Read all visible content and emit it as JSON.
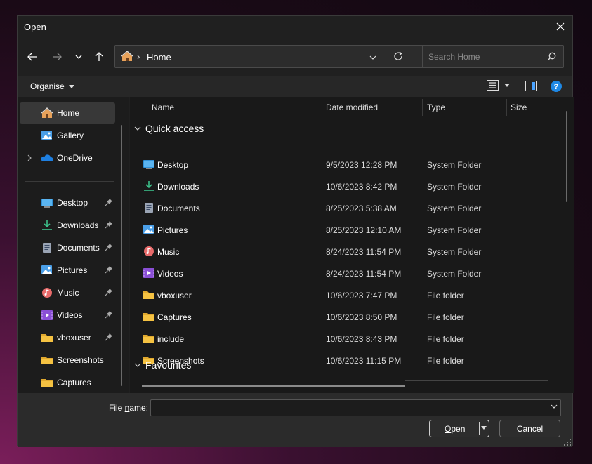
{
  "window": {
    "title": "Open"
  },
  "navigation": {
    "breadcrumb": "Home",
    "search_placeholder": "Search Home"
  },
  "toolbar": {
    "organise_label": "Organise"
  },
  "sidebar": {
    "top_items": [
      {
        "label": "Home",
        "icon": "home-icon",
        "selected": true
      },
      {
        "label": "Gallery",
        "icon": "gallery-icon"
      },
      {
        "label": "OneDrive",
        "icon": "onedrive-icon",
        "expandable": true
      }
    ],
    "pinned_items": [
      {
        "label": "Desktop",
        "icon": "desktop-icon",
        "pinned": true
      },
      {
        "label": "Downloads",
        "icon": "downloads-icon",
        "pinned": true
      },
      {
        "label": "Documents",
        "icon": "documents-icon",
        "pinned": true
      },
      {
        "label": "Pictures",
        "icon": "pictures-icon",
        "pinned": true
      },
      {
        "label": "Music",
        "icon": "music-icon",
        "pinned": true
      },
      {
        "label": "Videos",
        "icon": "videos-icon",
        "pinned": true
      },
      {
        "label": "vboxuser",
        "icon": "folder-icon",
        "pinned": true
      },
      {
        "label": "Screenshots",
        "icon": "folder-icon",
        "pinned": false
      },
      {
        "label": "Captures",
        "icon": "folder-icon",
        "pinned": false
      }
    ]
  },
  "file_list": {
    "columns": {
      "name": "Name",
      "date": "Date modified",
      "type": "Type",
      "size": "Size"
    },
    "groups": {
      "quick_access": "Quick access",
      "favourites": "Favourites"
    },
    "rows": [
      {
        "name": "Desktop",
        "date": "9/5/2023 12:28 PM",
        "type": "System Folder",
        "icon": "desktop-icon"
      },
      {
        "name": "Downloads",
        "date": "10/6/2023 8:42 PM",
        "type": "System Folder",
        "icon": "downloads-icon"
      },
      {
        "name": "Documents",
        "date": "8/25/2023 5:38 AM",
        "type": "System Folder",
        "icon": "documents-icon"
      },
      {
        "name": "Pictures",
        "date": "8/25/2023 12:10 AM",
        "type": "System Folder",
        "icon": "pictures-icon"
      },
      {
        "name": "Music",
        "date": "8/24/2023 11:54 PM",
        "type": "System Folder",
        "icon": "music-icon"
      },
      {
        "name": "Videos",
        "date": "8/24/2023 11:54 PM",
        "type": "System Folder",
        "icon": "videos-icon"
      },
      {
        "name": "vboxuser",
        "date": "10/6/2023 7:47 PM",
        "type": "File folder",
        "icon": "folder-icon"
      },
      {
        "name": "Captures",
        "date": "10/6/2023 8:50 PM",
        "type": "File folder",
        "icon": "folder-icon"
      },
      {
        "name": "include",
        "date": "10/6/2023 8:43 PM",
        "type": "File folder",
        "icon": "folder-icon"
      },
      {
        "name": "Screenshots",
        "date": "10/6/2023 11:15 PM",
        "type": "File folder",
        "icon": "folder-icon"
      }
    ]
  },
  "footer": {
    "file_name_label_pre": "File ",
    "file_name_label_u": "n",
    "file_name_label_post": "ame:",
    "file_name_value": "",
    "open_label_u": "O",
    "open_label_post": "pen",
    "cancel_label": "Cancel"
  },
  "colors": {
    "dialog_bg": "#202020",
    "sidebar_bg": "#1c1c1c",
    "list_bg": "#191919",
    "help_blue": "#1e88e5",
    "folder_yellow": "#f5c242"
  }
}
